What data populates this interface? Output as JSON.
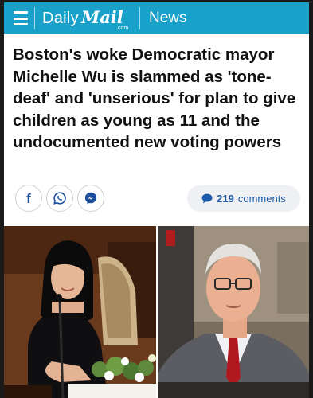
{
  "header": {
    "logo_daily": "Daily",
    "logo_mail": "Mail",
    "logo_com": ".com",
    "section": "News",
    "bg_color": "#1aa1c9"
  },
  "article": {
    "headline": "Boston's woke Democratic mayor Michelle Wu is slammed as 'tone-deaf' and 'unserious' for plan to give children as young as 11 and the undocumented new voting powers"
  },
  "share": {
    "buttons": [
      {
        "icon": "facebook-icon",
        "color": "#1c4e9c"
      },
      {
        "icon": "whatsapp-icon",
        "color": "#1c4e9c"
      },
      {
        "icon": "messenger-icon",
        "color": "#1c4e9c"
      }
    ]
  },
  "comments": {
    "count": "219",
    "label": "comments",
    "icon": "speech-bubble-icon",
    "color": "#1b5aa8"
  },
  "photos": [
    {
      "subject": "woman-at-microphone"
    },
    {
      "subject": "man-in-glasses"
    }
  ]
}
